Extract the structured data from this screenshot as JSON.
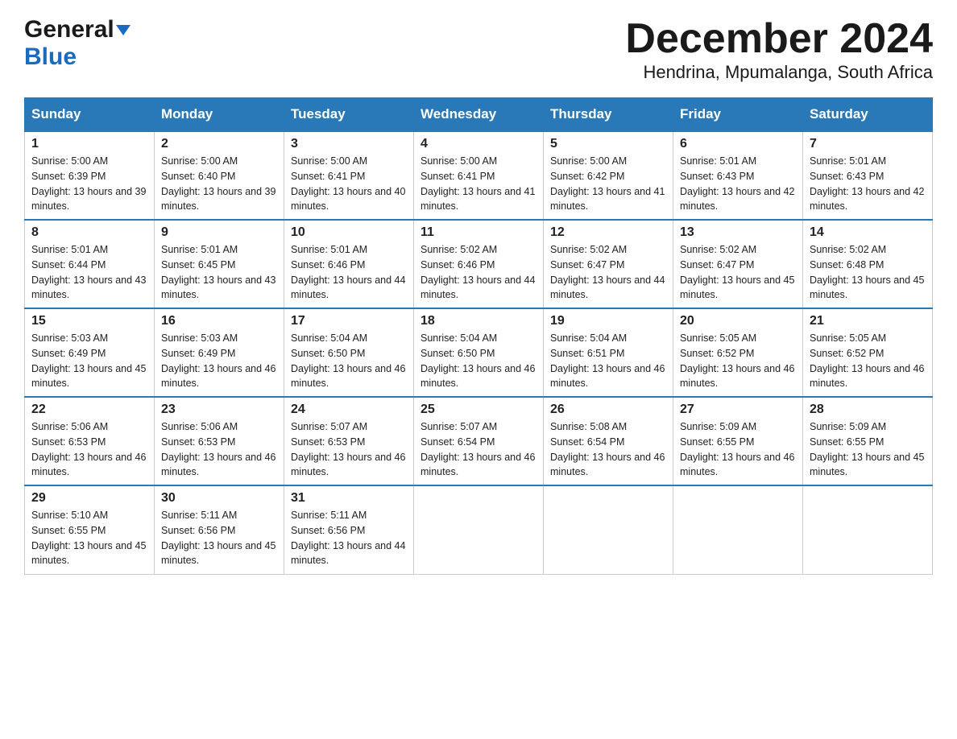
{
  "header": {
    "month_title": "December 2024",
    "location": "Hendrina, Mpumalanga, South Africa",
    "logo_general": "General",
    "logo_blue": "Blue"
  },
  "days_of_week": [
    "Sunday",
    "Monday",
    "Tuesday",
    "Wednesday",
    "Thursday",
    "Friday",
    "Saturday"
  ],
  "weeks": [
    [
      {
        "day": "1",
        "sunrise": "5:00 AM",
        "sunset": "6:39 PM",
        "daylight": "13 hours and 39 minutes."
      },
      {
        "day": "2",
        "sunrise": "5:00 AM",
        "sunset": "6:40 PM",
        "daylight": "13 hours and 39 minutes."
      },
      {
        "day": "3",
        "sunrise": "5:00 AM",
        "sunset": "6:41 PM",
        "daylight": "13 hours and 40 minutes."
      },
      {
        "day": "4",
        "sunrise": "5:00 AM",
        "sunset": "6:41 PM",
        "daylight": "13 hours and 41 minutes."
      },
      {
        "day": "5",
        "sunrise": "5:00 AM",
        "sunset": "6:42 PM",
        "daylight": "13 hours and 41 minutes."
      },
      {
        "day": "6",
        "sunrise": "5:01 AM",
        "sunset": "6:43 PM",
        "daylight": "13 hours and 42 minutes."
      },
      {
        "day": "7",
        "sunrise": "5:01 AM",
        "sunset": "6:43 PM",
        "daylight": "13 hours and 42 minutes."
      }
    ],
    [
      {
        "day": "8",
        "sunrise": "5:01 AM",
        "sunset": "6:44 PM",
        "daylight": "13 hours and 43 minutes."
      },
      {
        "day": "9",
        "sunrise": "5:01 AM",
        "sunset": "6:45 PM",
        "daylight": "13 hours and 43 minutes."
      },
      {
        "day": "10",
        "sunrise": "5:01 AM",
        "sunset": "6:46 PM",
        "daylight": "13 hours and 44 minutes."
      },
      {
        "day": "11",
        "sunrise": "5:02 AM",
        "sunset": "6:46 PM",
        "daylight": "13 hours and 44 minutes."
      },
      {
        "day": "12",
        "sunrise": "5:02 AM",
        "sunset": "6:47 PM",
        "daylight": "13 hours and 44 minutes."
      },
      {
        "day": "13",
        "sunrise": "5:02 AM",
        "sunset": "6:47 PM",
        "daylight": "13 hours and 45 minutes."
      },
      {
        "day": "14",
        "sunrise": "5:02 AM",
        "sunset": "6:48 PM",
        "daylight": "13 hours and 45 minutes."
      }
    ],
    [
      {
        "day": "15",
        "sunrise": "5:03 AM",
        "sunset": "6:49 PM",
        "daylight": "13 hours and 45 minutes."
      },
      {
        "day": "16",
        "sunrise": "5:03 AM",
        "sunset": "6:49 PM",
        "daylight": "13 hours and 46 minutes."
      },
      {
        "day": "17",
        "sunrise": "5:04 AM",
        "sunset": "6:50 PM",
        "daylight": "13 hours and 46 minutes."
      },
      {
        "day": "18",
        "sunrise": "5:04 AM",
        "sunset": "6:50 PM",
        "daylight": "13 hours and 46 minutes."
      },
      {
        "day": "19",
        "sunrise": "5:04 AM",
        "sunset": "6:51 PM",
        "daylight": "13 hours and 46 minutes."
      },
      {
        "day": "20",
        "sunrise": "5:05 AM",
        "sunset": "6:52 PM",
        "daylight": "13 hours and 46 minutes."
      },
      {
        "day": "21",
        "sunrise": "5:05 AM",
        "sunset": "6:52 PM",
        "daylight": "13 hours and 46 minutes."
      }
    ],
    [
      {
        "day": "22",
        "sunrise": "5:06 AM",
        "sunset": "6:53 PM",
        "daylight": "13 hours and 46 minutes."
      },
      {
        "day": "23",
        "sunrise": "5:06 AM",
        "sunset": "6:53 PM",
        "daylight": "13 hours and 46 minutes."
      },
      {
        "day": "24",
        "sunrise": "5:07 AM",
        "sunset": "6:53 PM",
        "daylight": "13 hours and 46 minutes."
      },
      {
        "day": "25",
        "sunrise": "5:07 AM",
        "sunset": "6:54 PM",
        "daylight": "13 hours and 46 minutes."
      },
      {
        "day": "26",
        "sunrise": "5:08 AM",
        "sunset": "6:54 PM",
        "daylight": "13 hours and 46 minutes."
      },
      {
        "day": "27",
        "sunrise": "5:09 AM",
        "sunset": "6:55 PM",
        "daylight": "13 hours and 46 minutes."
      },
      {
        "day": "28",
        "sunrise": "5:09 AM",
        "sunset": "6:55 PM",
        "daylight": "13 hours and 45 minutes."
      }
    ],
    [
      {
        "day": "29",
        "sunrise": "5:10 AM",
        "sunset": "6:55 PM",
        "daylight": "13 hours and 45 minutes."
      },
      {
        "day": "30",
        "sunrise": "5:11 AM",
        "sunset": "6:56 PM",
        "daylight": "13 hours and 45 minutes."
      },
      {
        "day": "31",
        "sunrise": "5:11 AM",
        "sunset": "6:56 PM",
        "daylight": "13 hours and 44 minutes."
      },
      null,
      null,
      null,
      null
    ]
  ]
}
